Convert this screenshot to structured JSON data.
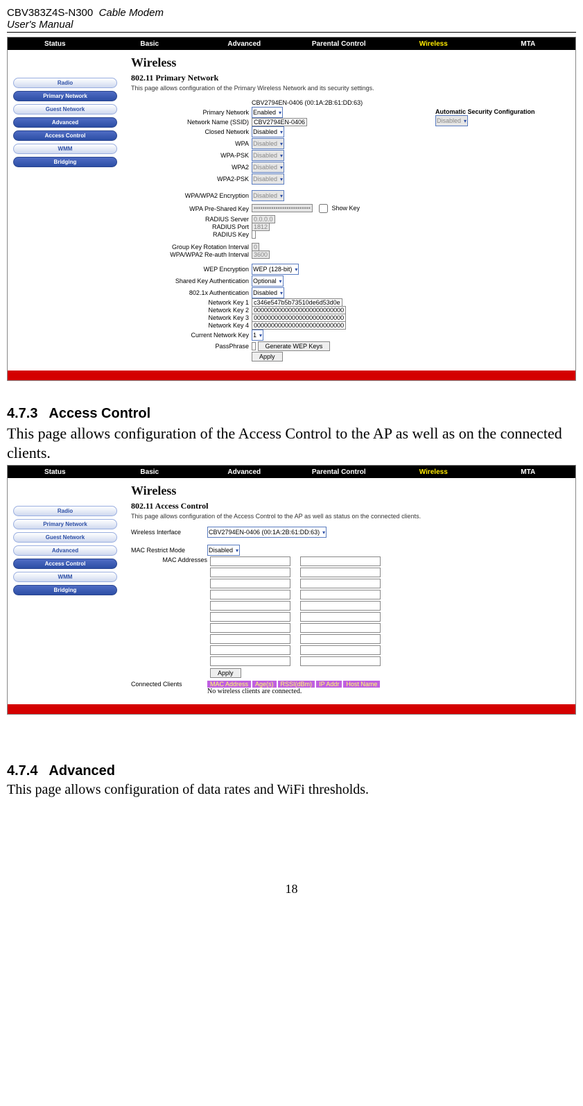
{
  "header": {
    "model": "CBV383Z4S-N300",
    "product_italic": "Cable Modem",
    "manual": "User's Manual"
  },
  "tabs": [
    "Status",
    "Basic",
    "Advanced",
    "Parental Control",
    "Wireless",
    "MTA"
  ],
  "active_tab": "Wireless",
  "sidebar_items": [
    "Radio",
    "Primary Network",
    "Guest Network",
    "Advanced",
    "Access Control",
    "WMM",
    "Bridging"
  ],
  "shot1": {
    "title": "Wireless",
    "subtitle": "802.11 Primary Network",
    "desc": "This page allows configuration of the Primary Wireless Network and its security settings.",
    "mac_line": "CBV2794EN-0406 (00:1A:2B:61:DD:63)",
    "auto_sec_label": "Automatic Security Configuration",
    "auto_sec_value": "Disabled",
    "rows": {
      "primary_network_label": "Primary Network",
      "primary_network_value": "Enabled",
      "ssid_label": "Network Name (SSID)",
      "ssid_value": "CBV2794EN-0406",
      "closed_label": "Closed Network",
      "closed_value": "Disabled",
      "wpa_label": "WPA",
      "wpa_value": "Disabled",
      "wpa_psk_label": "WPA-PSK",
      "wpa_psk_value": "Disabled",
      "wpa2_label": "WPA2",
      "wpa2_value": "Disabled",
      "wpa2_psk_label": "WPA2-PSK",
      "wpa2_psk_value": "Disabled",
      "enc_label": "WPA/WPA2 Encryption",
      "enc_value": "Disabled",
      "psk_label": "WPA Pre-Shared Key",
      "psk_value": "••••••••••••••••••••••••••",
      "showkey_label": "Show Key",
      "radius_srv_label": "RADIUS Server",
      "radius_srv_value": "0.0.0.0",
      "radius_port_label": "RADIUS Port",
      "radius_port_value": "1812",
      "radius_key_label": "RADIUS Key",
      "radius_key_value": "",
      "gkri_label": "Group Key Rotation Interval",
      "gkri_value": "0",
      "reauth_label": "WPA/WPA2 Re-auth Interval",
      "reauth_value": "3600",
      "wep_enc_label": "WEP Encryption",
      "wep_enc_value": "WEP (128-bit)",
      "shared_auth_label": "Shared Key Authentication",
      "shared_auth_value": "Optional",
      "dot1x_label": "802.1x Authentication",
      "dot1x_value": "Disabled",
      "nk1_label": "Network Key 1",
      "nk1_value": "c346e547b5b73510de6d53d0e",
      "nk2_label": "Network Key 2",
      "nk2_value": "00000000000000000000000000",
      "nk3_label": "Network Key 3",
      "nk3_value": "00000000000000000000000000",
      "nk4_label": "Network Key 4",
      "nk4_value": "00000000000000000000000000",
      "curkey_label": "Current Network Key",
      "curkey_value": "1",
      "passphrase_label": "PassPhrase",
      "passphrase_value": "",
      "gen_btn": "Generate WEP Keys",
      "apply_btn": "Apply"
    }
  },
  "section_473": {
    "num": "4.7.3",
    "title": "Access Control",
    "body": "This page allows configuration of the Access Control to the AP as well as on the connected clients."
  },
  "shot2": {
    "title": "Wireless",
    "subtitle": "802.11 Access Control",
    "desc": "This page allows configuration of the Access Control to the AP as well as status on the connected clients.",
    "wiface_label": "Wireless Interface",
    "wiface_value": "CBV2794EN-0406 (00:1A:2B:61:DD:63)",
    "restrict_label": "MAC Restrict Mode",
    "restrict_value": "Disabled",
    "mac_addr_label": "MAC Addresses",
    "apply_btn": "Apply",
    "connected_label": "Connected Clients",
    "table_headers": [
      "MAC Address",
      "Age(s)",
      "RSSI(dBm)",
      "IP Addr",
      "Host Name"
    ],
    "no_clients": "No wireless clients are connected."
  },
  "section_474": {
    "num": "4.7.4",
    "title": "Advanced",
    "body": "This page allows configuration of data rates and WiFi  thresholds."
  },
  "page_number": "18"
}
